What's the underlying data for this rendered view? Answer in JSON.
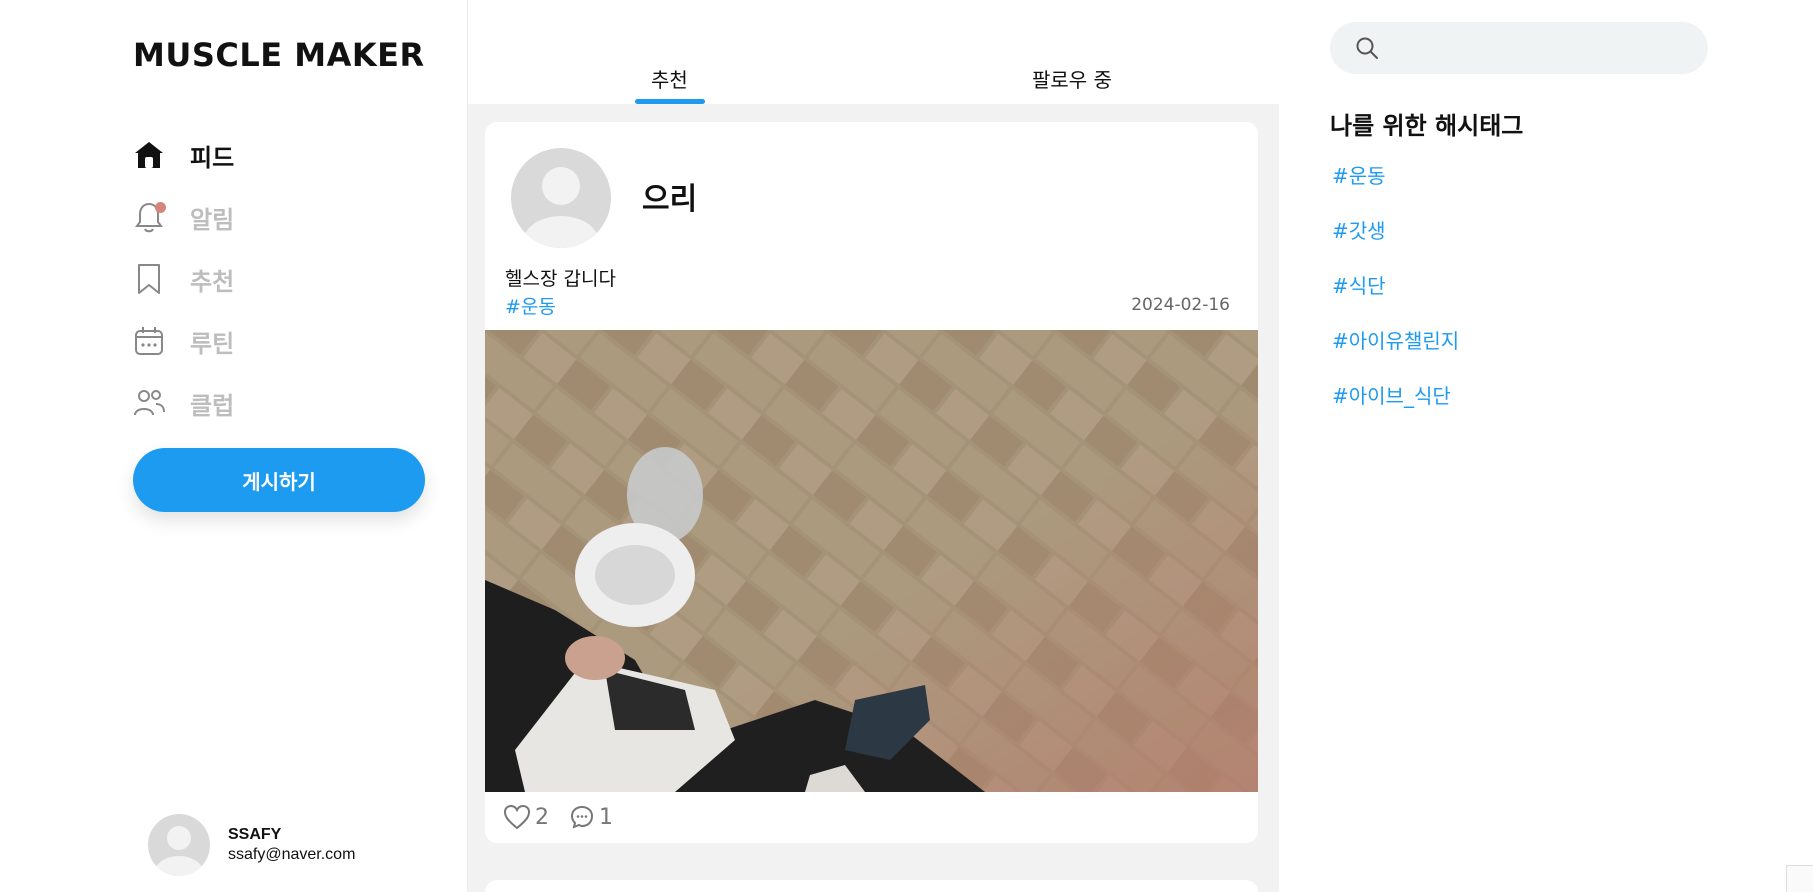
{
  "app": {
    "logo": "MUSCLE MAKER"
  },
  "nav": {
    "items": [
      {
        "label": "피드",
        "icon": "home-icon",
        "active": true
      },
      {
        "label": "알림",
        "icon": "bell-icon",
        "active": false,
        "has_badge": true
      },
      {
        "label": "추천",
        "icon": "bookmark-icon",
        "active": false
      },
      {
        "label": "루틴",
        "icon": "calendar-icon",
        "active": false
      },
      {
        "label": "클럽",
        "icon": "users-icon",
        "active": false
      }
    ],
    "post_button": "게시하기"
  },
  "user": {
    "name": "SSAFY",
    "email": "ssafy@naver.com"
  },
  "feed": {
    "tabs": [
      {
        "label": "추천",
        "active": true
      },
      {
        "label": "팔로우 중",
        "active": false
      }
    ],
    "posts": [
      {
        "author": "으리",
        "text": "헬스장 갑니다",
        "hashtag": "#운동",
        "date": "2024-02-16",
        "likes": "2",
        "comments": "1",
        "image": "photo of sneakers on brick pavement"
      }
    ]
  },
  "sidebar_right": {
    "search": {
      "placeholder": "",
      "value": ""
    },
    "hashtags_title": "나를 위한 해시태그",
    "hashtags": [
      "#운동",
      "#갓생",
      "#식단",
      "#아이유챌린지",
      "#아이브_식단"
    ]
  },
  "colors": {
    "accent": "#1d9bf0",
    "badge": "#d4867a",
    "feed_bg": "#f2f2f2",
    "inactive": "#bdbdbd"
  }
}
